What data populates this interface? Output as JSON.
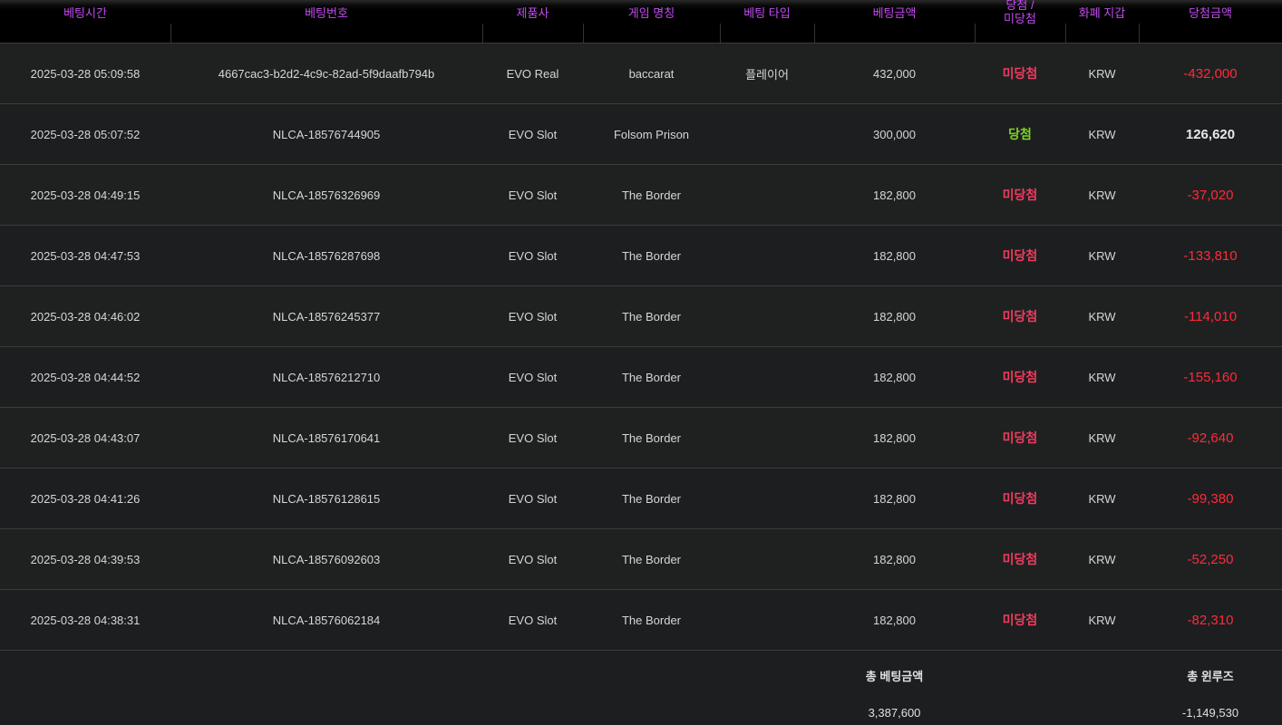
{
  "headers": [
    {
      "label": "베팅시간"
    },
    {
      "label": "베팅번호"
    },
    {
      "label": "제품사"
    },
    {
      "label": "게임 명칭"
    },
    {
      "label": "베팅 타입"
    },
    {
      "label": "베팅금액"
    },
    {
      "label": "당첨 /",
      "label2": "미당첨"
    },
    {
      "label": "화폐 지갑"
    },
    {
      "label": "당첨금액"
    }
  ],
  "rows": [
    {
      "time": "2025-03-28 05:09:58",
      "id": "4667cac3-b2d2-4c9c-82ad-5f9daafb794b",
      "vendor": "EVO Real",
      "game": "baccarat",
      "bet_type": "플레이어",
      "bet": "432,000",
      "result": "미당첨",
      "currency": "KRW",
      "win": "-432,000"
    },
    {
      "time": "2025-03-28 05:07:52",
      "id": "NLCA-18576744905",
      "vendor": "EVO Slot",
      "game": "Folsom Prison",
      "bet_type": "",
      "bet": "300,000",
      "result": "당첨",
      "currency": "KRW",
      "win": "126,620"
    },
    {
      "time": "2025-03-28 04:49:15",
      "id": "NLCA-18576326969",
      "vendor": "EVO Slot",
      "game": "The Border",
      "bet_type": "",
      "bet": "182,800",
      "result": "미당첨",
      "currency": "KRW",
      "win": "-37,020"
    },
    {
      "time": "2025-03-28 04:47:53",
      "id": "NLCA-18576287698",
      "vendor": "EVO Slot",
      "game": "The Border",
      "bet_type": "",
      "bet": "182,800",
      "result": "미당첨",
      "currency": "KRW",
      "win": "-133,810"
    },
    {
      "time": "2025-03-28 04:46:02",
      "id": "NLCA-18576245377",
      "vendor": "EVO Slot",
      "game": "The Border",
      "bet_type": "",
      "bet": "182,800",
      "result": "미당첨",
      "currency": "KRW",
      "win": "-114,010"
    },
    {
      "time": "2025-03-28 04:44:52",
      "id": "NLCA-18576212710",
      "vendor": "EVO Slot",
      "game": "The Border",
      "bet_type": "",
      "bet": "182,800",
      "result": "미당첨",
      "currency": "KRW",
      "win": "-155,160"
    },
    {
      "time": "2025-03-28 04:43:07",
      "id": "NLCA-18576170641",
      "vendor": "EVO Slot",
      "game": "The Border",
      "bet_type": "",
      "bet": "182,800",
      "result": "미당첨",
      "currency": "KRW",
      "win": "-92,640"
    },
    {
      "time": "2025-03-28 04:41:26",
      "id": "NLCA-18576128615",
      "vendor": "EVO Slot",
      "game": "The Border",
      "bet_type": "",
      "bet": "182,800",
      "result": "미당첨",
      "currency": "KRW",
      "win": "-99,380"
    },
    {
      "time": "2025-03-28 04:39:53",
      "id": "NLCA-18576092603",
      "vendor": "EVO Slot",
      "game": "The Border",
      "bet_type": "",
      "bet": "182,800",
      "result": "미당첨",
      "currency": "KRW",
      "win": "-52,250"
    },
    {
      "time": "2025-03-28 04:38:31",
      "id": "NLCA-18576062184",
      "vendor": "EVO Slot",
      "game": "The Border",
      "bet_type": "",
      "bet": "182,800",
      "result": "미당첨",
      "currency": "KRW",
      "win": "-82,310"
    }
  ],
  "footer": {
    "total_bet_label": "총 베팅금액",
    "total_bet": "3,387,600",
    "total_winloss_label": "총 윈루즈",
    "total_winloss": "-1,149,530"
  },
  "colors": {
    "header_text": "#c44bf2",
    "lose": "#ee3c5f",
    "win": "#7ed321",
    "negative_amount": "#ff2a3a"
  }
}
